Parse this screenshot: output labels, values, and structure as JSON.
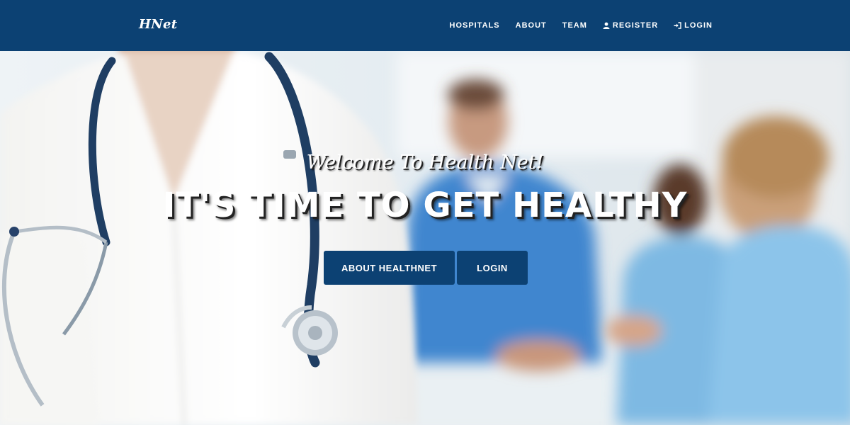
{
  "navbar": {
    "brand": "HNet",
    "items": [
      {
        "label": "HOSPITALS",
        "icon": null
      },
      {
        "label": "ABOUT",
        "icon": null
      },
      {
        "label": "TEAM",
        "icon": null
      },
      {
        "label": "REGISTER",
        "icon": "user-icon"
      },
      {
        "label": "LOGIN",
        "icon": "sign-in-icon"
      }
    ]
  },
  "hero": {
    "welcome": "Welcome To Health Net!",
    "headline": "IT'S TIME TO GET HEALTHY",
    "buttons": {
      "about": "ABOUT HEALTHNET",
      "login": "LOGIN"
    }
  },
  "colors": {
    "navbar_bg": "#0c4173",
    "button_bg": "#0c4173",
    "text": "#ffffff"
  }
}
